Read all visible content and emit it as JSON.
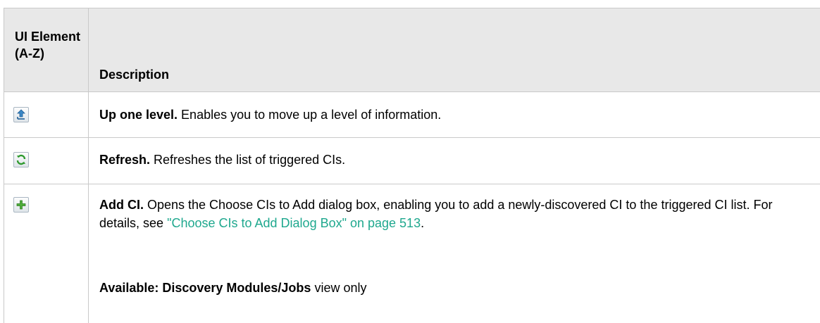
{
  "table": {
    "header": {
      "col1": "UI Element (A-Z)",
      "col2": "Description"
    },
    "rows": [
      {
        "icon": "up-one-level-icon",
        "bold": "Up one level.",
        "text": " Enables you to move up a level of information."
      },
      {
        "icon": "refresh-icon",
        "bold": "Refresh.",
        "text": " Refreshes the list of triggered CIs."
      },
      {
        "icon": "add-ci-icon",
        "bold": "Add CI.",
        "text": " Opens the Choose CIs to Add dialog box, enabling you to add a newly-discovered CI to the triggered CI list. For details, see ",
        "link": "\"Choose CIs to Add Dialog Box\" on page 513",
        "text_after": ".",
        "note_bold": "Available: Discovery Modules/Jobs",
        "note_text": " view only"
      }
    ]
  },
  "colors": {
    "header_bg": "#e8e8e8",
    "border": "#c9c9c9",
    "link": "#1fa88e"
  }
}
